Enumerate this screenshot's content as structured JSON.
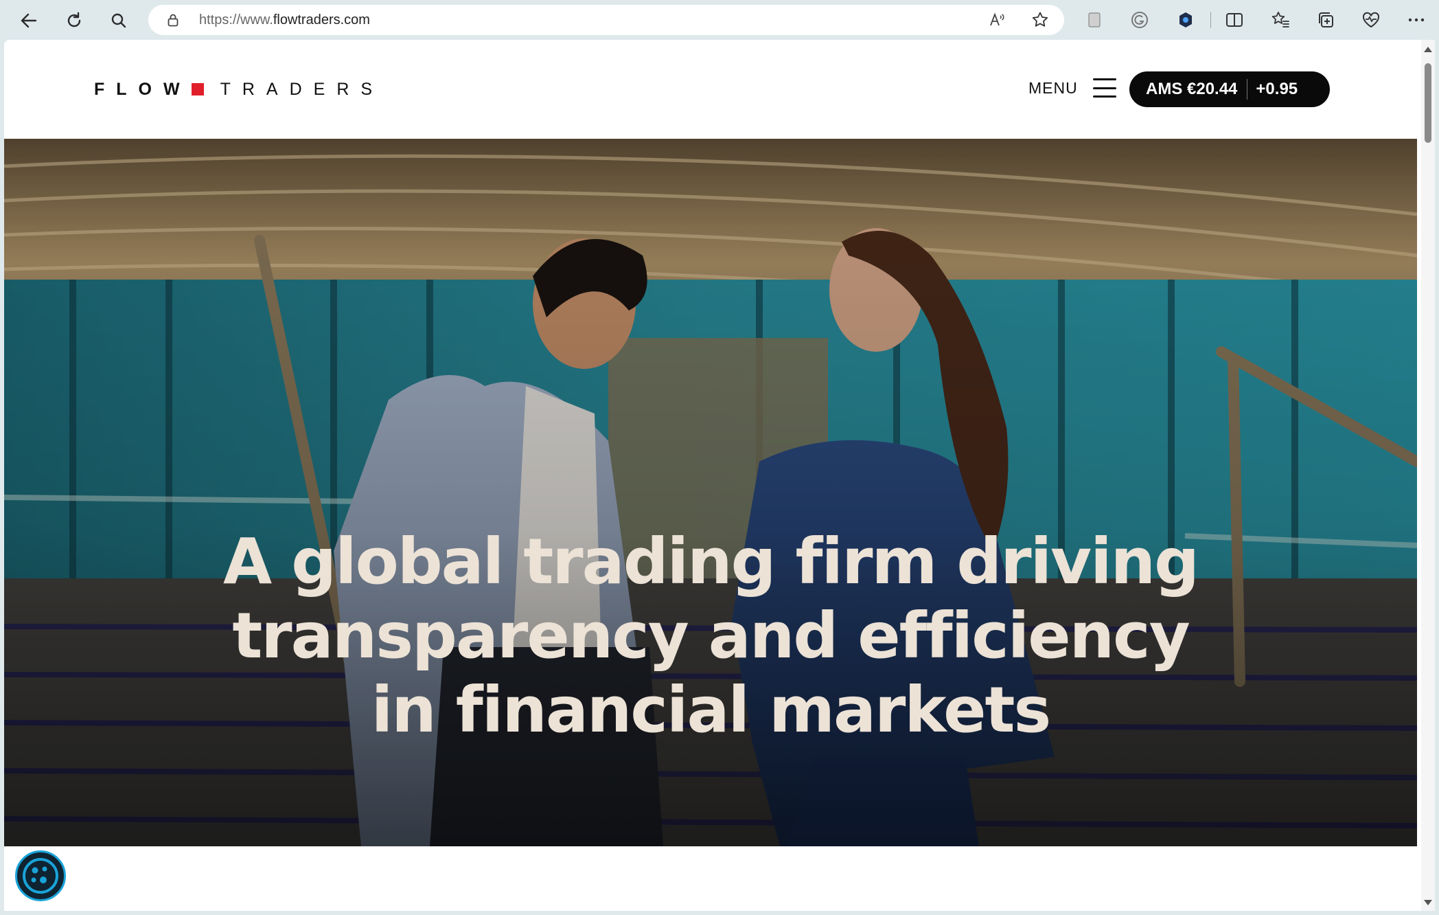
{
  "browser": {
    "url_prefix": "https://www.",
    "url_domain": "flowtraders.com"
  },
  "header": {
    "logo_left": "FLOW",
    "logo_right": "TRADERS",
    "menu_label": "MENU",
    "ticker_price": "AMS €20.44",
    "ticker_change": "+0.95"
  },
  "hero": {
    "line1": "A global trading firm driving",
    "line2": "transparency and efficiency",
    "line3": "in financial markets"
  },
  "colors": {
    "brand_red": "#e01f2a",
    "ticker_bg": "#0a0a0a",
    "hero_text": "#ece2d6"
  },
  "icons": [
    "back-icon",
    "refresh-icon",
    "search-icon",
    "lock-icon",
    "read-aloud-icon",
    "favorite-star-icon",
    "reading-view-icon",
    "grammarly-icon",
    "extension-icon",
    "split-screen-icon",
    "favorites-icon",
    "collections-icon",
    "health-icon",
    "more-icon",
    "menu-icon",
    "cookie-icon"
  ]
}
